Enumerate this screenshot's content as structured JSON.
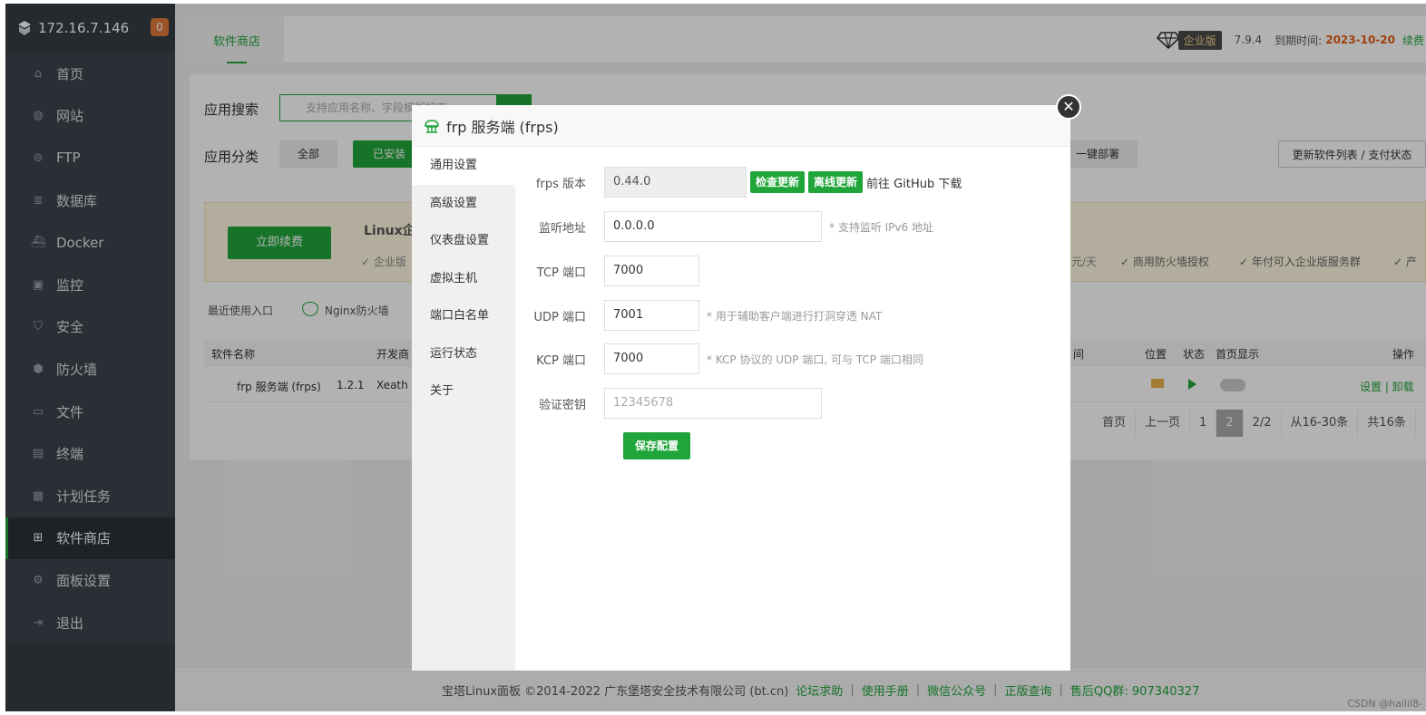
{
  "sidebar": {
    "host": "172.16.7.146",
    "badge": "0",
    "items": [
      {
        "label": "首页",
        "icon": "home-icon"
      },
      {
        "label": "网站",
        "icon": "globe-icon"
      },
      {
        "label": "FTP",
        "icon": "ftp-icon"
      },
      {
        "label": "数据库",
        "icon": "database-icon"
      },
      {
        "label": "Docker",
        "icon": "docker-icon"
      },
      {
        "label": "监控",
        "icon": "monitor-icon"
      },
      {
        "label": "安全",
        "icon": "shield-icon"
      },
      {
        "label": "防火墙",
        "icon": "firewall-icon"
      },
      {
        "label": "文件",
        "icon": "folder-icon"
      },
      {
        "label": "终端",
        "icon": "terminal-icon"
      },
      {
        "label": "计划任务",
        "icon": "calendar-icon"
      },
      {
        "label": "软件商店",
        "icon": "grid-icon"
      },
      {
        "label": "面板设置",
        "icon": "gear-icon"
      },
      {
        "label": "退出",
        "icon": "logout-icon"
      }
    ],
    "active_index": 11
  },
  "topbar": {
    "tab": "软件商店",
    "edition": "企业版",
    "version": "7.9.4",
    "expire_label": "到期时间:",
    "expire_date": "2023-10-20",
    "renew": "续费"
  },
  "store": {
    "search_label": "应用搜索",
    "search_placeholder": "支持应用名称、字段模糊搜索",
    "category_label": "应用分类",
    "cat_all": "全部",
    "cat_installed": "已安装",
    "one_click": "一键部署",
    "update_list": "更新软件列表 / 支付状态",
    "renew_btn": "立即续费",
    "banner_title": "Linux企",
    "banner_left": "✓ 企业版",
    "banner_price": "元/天",
    "perk1": "✓ 商用防火墙授权",
    "perk2": "✓ 年付可入企业版服务群",
    "perk3": "✓ 产",
    "recent_label": "最近使用入口",
    "recent_item": "Nginx防火墙",
    "col_name": "软件名称",
    "col_dev": "开发商",
    "col_time": "间",
    "col_pos": "位置",
    "col_status": "状态",
    "col_home": "首页显示",
    "col_op": "操作",
    "row_name": "frp 服务端 (frps)",
    "row_ver": "1.2.1",
    "row_dev": "Xeath",
    "row_ops": "设置 | 卸载",
    "pager": [
      "首页",
      "上一页",
      "1",
      "2",
      "2/2",
      "从16-30条",
      "共16条"
    ]
  },
  "footer": {
    "copyright": "宝塔Linux面板 ©2014-2022 广东堡塔安全技术有限公司 (bt.cn)",
    "links": [
      "论坛求助",
      "使用手册",
      "微信公众号",
      "正版查询"
    ],
    "qq": "售后QQ群: 907340327",
    "watermark": "CSDN @hailil8-"
  },
  "modal": {
    "title": "frp 服务端 (frps)",
    "tabs": [
      "通用设置",
      "高级设置",
      "仪表盘设置",
      "虚拟主机",
      "端口白名单",
      "运行状态",
      "关于"
    ],
    "version_label": "frps 版本",
    "version_value": "0.44.0",
    "check_update": "检查更新",
    "offline_update": "离线更新",
    "github": "前往 GitHub 下载",
    "listen_label": "监听地址",
    "listen_value": "0.0.0.0",
    "listen_note": "* 支持监听 IPv6 地址",
    "tcp_label": "TCP 端口",
    "tcp_value": "7000",
    "udp_label": "UDP 端口",
    "udp_value": "7001",
    "udp_note": "* 用于辅助客户端进行打洞穿透 NAT",
    "kcp_label": "KCP 端口",
    "kcp_value": "7000",
    "kcp_note": "* KCP 协议的 UDP 端口, 可与 TCP 端口相同",
    "token_label": "验证密钥",
    "token_value": "12345678",
    "save": "保存配置"
  },
  "colors": {
    "accent": "#20a53a",
    "sidebar": "#3c444d",
    "expire": "#e05b14"
  }
}
